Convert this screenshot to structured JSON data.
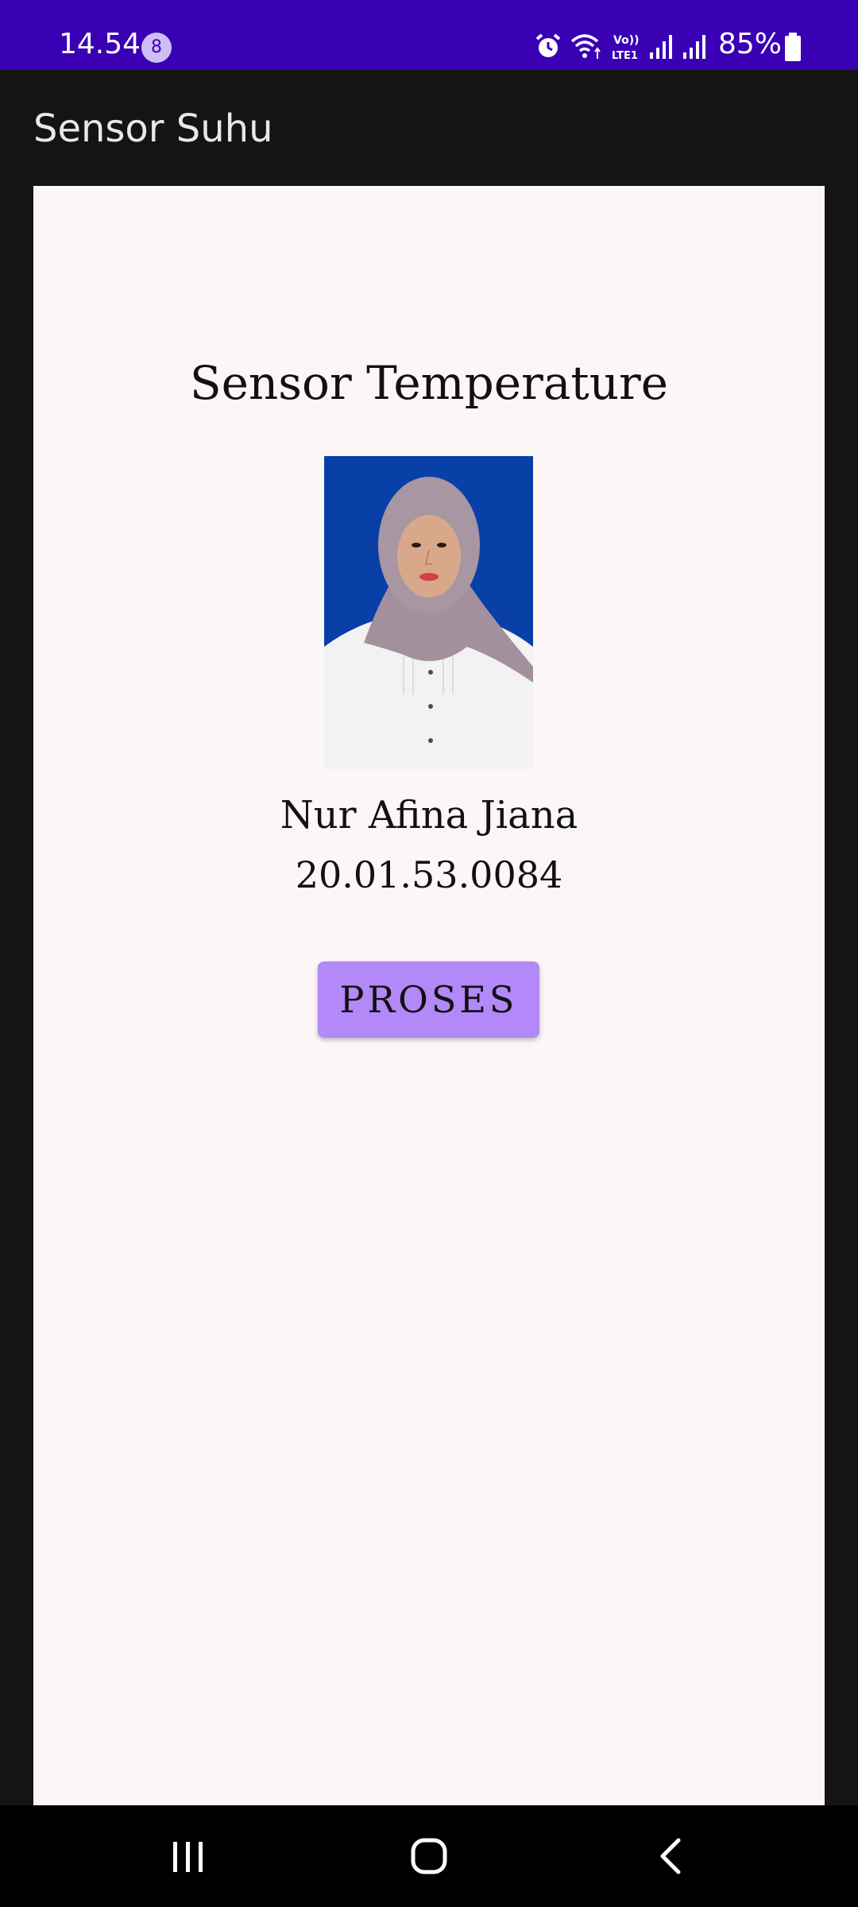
{
  "status_bar": {
    "time": "14.54",
    "notification_count": "8",
    "battery": "85%",
    "icons": [
      "alarm-icon",
      "wifi-icon",
      "volte-lte-icon",
      "signal-icon",
      "signal-icon",
      "battery-icon"
    ],
    "background_color": "#3a00b4"
  },
  "app_bar": {
    "title": "Sensor Suhu"
  },
  "main": {
    "heading": "Sensor Temperature",
    "photo": "profile-photo",
    "name": "Nur Afina Jiana",
    "student_id": "20.01.53.0084",
    "button_label": "PROSES",
    "button_color": "#b388f8"
  },
  "nav_bar": {
    "buttons": [
      "recent-apps-icon",
      "home-icon",
      "back-icon"
    ]
  }
}
